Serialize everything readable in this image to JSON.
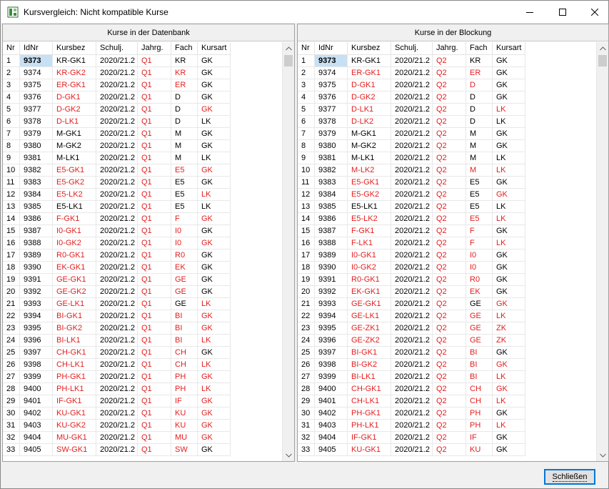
{
  "window": {
    "title": "Kursvergleich: Nicht kompatible Kurse"
  },
  "columns": [
    "Nr",
    "IdNr",
    "Kursbez",
    "Schulj.",
    "Jahrg.",
    "Fach",
    "Kursart"
  ],
  "left": {
    "title": "Kurse in der Datenbank",
    "rows": [
      [
        "1",
        "9373",
        "KR-GK1",
        "2020/21.2",
        "Q1",
        "KR",
        "GK"
      ],
      [
        "2",
        "9374",
        "KR-GK2",
        "2020/21.2",
        "Q1",
        "KR",
        "GK"
      ],
      [
        "3",
        "9375",
        "ER-GK1",
        "2020/21.2",
        "Q1",
        "ER",
        "GK"
      ],
      [
        "4",
        "9376",
        "D-GK1",
        "2020/21.2",
        "Q1",
        "D",
        "GK"
      ],
      [
        "5",
        "9377",
        "D-GK2",
        "2020/21.2",
        "Q1",
        "D",
        "GK"
      ],
      [
        "6",
        "9378",
        "D-LK1",
        "2020/21.2",
        "Q1",
        "D",
        "LK"
      ],
      [
        "7",
        "9379",
        "M-GK1",
        "2020/21.2",
        "Q1",
        "M",
        "GK"
      ],
      [
        "8",
        "9380",
        "M-GK2",
        "2020/21.2",
        "Q1",
        "M",
        "GK"
      ],
      [
        "9",
        "9381",
        "M-LK1",
        "2020/21.2",
        "Q1",
        "M",
        "LK"
      ],
      [
        "10",
        "9382",
        "E5-GK1",
        "2020/21.2",
        "Q1",
        "E5",
        "GK"
      ],
      [
        "11",
        "9383",
        "E5-GK2",
        "2020/21.2",
        "Q1",
        "E5",
        "GK"
      ],
      [
        "12",
        "9384",
        "E5-LK2",
        "2020/21.2",
        "Q1",
        "E5",
        "LK"
      ],
      [
        "13",
        "9385",
        "E5-LK1",
        "2020/21.2",
        "Q1",
        "E5",
        "LK"
      ],
      [
        "14",
        "9386",
        "F-GK1",
        "2020/21.2",
        "Q1",
        "F",
        "GK"
      ],
      [
        "15",
        "9387",
        "I0-GK1",
        "2020/21.2",
        "Q1",
        "I0",
        "GK"
      ],
      [
        "16",
        "9388",
        "I0-GK2",
        "2020/21.2",
        "Q1",
        "I0",
        "GK"
      ],
      [
        "17",
        "9389",
        "R0-GK1",
        "2020/21.2",
        "Q1",
        "R0",
        "GK"
      ],
      [
        "18",
        "9390",
        "EK-GK1",
        "2020/21.2",
        "Q1",
        "EK",
        "GK"
      ],
      [
        "19",
        "9391",
        "GE-GK1",
        "2020/21.2",
        "Q1",
        "GE",
        "GK"
      ],
      [
        "20",
        "9392",
        "GE-GK2",
        "2020/21.2",
        "Q1",
        "GE",
        "GK"
      ],
      [
        "21",
        "9393",
        "GE-LK1",
        "2020/21.2",
        "Q1",
        "GE",
        "LK"
      ],
      [
        "22",
        "9394",
        "BI-GK1",
        "2020/21.2",
        "Q1",
        "BI",
        "GK"
      ],
      [
        "23",
        "9395",
        "BI-GK2",
        "2020/21.2",
        "Q1",
        "BI",
        "GK"
      ],
      [
        "24",
        "9396",
        "BI-LK1",
        "2020/21.2",
        "Q1",
        "BI",
        "LK"
      ],
      [
        "25",
        "9397",
        "CH-GK1",
        "2020/21.2",
        "Q1",
        "CH",
        "GK"
      ],
      [
        "26",
        "9398",
        "CH-LK1",
        "2020/21.2",
        "Q1",
        "CH",
        "LK"
      ],
      [
        "27",
        "9399",
        "PH-GK1",
        "2020/21.2",
        "Q1",
        "PH",
        "GK"
      ],
      [
        "28",
        "9400",
        "PH-LK1",
        "2020/21.2",
        "Q1",
        "PH",
        "LK"
      ],
      [
        "29",
        "9401",
        "IF-GK1",
        "2020/21.2",
        "Q1",
        "IF",
        "GK"
      ],
      [
        "30",
        "9402",
        "KU-GK1",
        "2020/21.2",
        "Q1",
        "KU",
        "GK"
      ],
      [
        "31",
        "9403",
        "KU-GK2",
        "2020/21.2",
        "Q1",
        "KU",
        "GK"
      ],
      [
        "32",
        "9404",
        "MU-GK1",
        "2020/21.2",
        "Q1",
        "MU",
        "GK"
      ],
      [
        "33",
        "9405",
        "SW-GK1",
        "2020/21.2",
        "Q1",
        "SW",
        "GK"
      ]
    ],
    "red": [
      [
        0,
        0,
        0,
        0,
        1,
        0,
        0
      ],
      [
        0,
        0,
        1,
        0,
        1,
        1,
        0
      ],
      [
        0,
        0,
        1,
        0,
        1,
        1,
        0
      ],
      [
        0,
        0,
        1,
        0,
        1,
        0,
        0
      ],
      [
        0,
        0,
        1,
        0,
        1,
        0,
        1
      ],
      [
        0,
        0,
        1,
        0,
        1,
        0,
        0
      ],
      [
        0,
        0,
        0,
        0,
        1,
        0,
        0
      ],
      [
        0,
        0,
        0,
        0,
        1,
        0,
        0
      ],
      [
        0,
        0,
        0,
        0,
        1,
        0,
        0
      ],
      [
        0,
        0,
        1,
        0,
        1,
        1,
        1
      ],
      [
        0,
        0,
        1,
        0,
        1,
        0,
        0
      ],
      [
        0,
        0,
        1,
        0,
        1,
        0,
        1
      ],
      [
        0,
        0,
        0,
        0,
        1,
        0,
        0
      ],
      [
        0,
        0,
        1,
        0,
        1,
        1,
        1
      ],
      [
        0,
        0,
        1,
        0,
        1,
        1,
        0
      ],
      [
        0,
        0,
        1,
        0,
        1,
        1,
        1
      ],
      [
        0,
        0,
        1,
        0,
        1,
        1,
        0
      ],
      [
        0,
        0,
        1,
        0,
        1,
        1,
        0
      ],
      [
        0,
        0,
        1,
        0,
        1,
        1,
        0
      ],
      [
        0,
        0,
        1,
        0,
        1,
        1,
        0
      ],
      [
        0,
        0,
        1,
        0,
        1,
        0,
        1
      ],
      [
        0,
        0,
        1,
        0,
        1,
        1,
        1
      ],
      [
        0,
        0,
        1,
        0,
        1,
        1,
        1
      ],
      [
        0,
        0,
        1,
        0,
        1,
        1,
        1
      ],
      [
        0,
        0,
        1,
        0,
        1,
        1,
        0
      ],
      [
        0,
        0,
        1,
        0,
        1,
        1,
        1
      ],
      [
        0,
        0,
        1,
        0,
        1,
        1,
        1
      ],
      [
        0,
        0,
        1,
        0,
        1,
        1,
        1
      ],
      [
        0,
        0,
        1,
        0,
        1,
        1,
        1
      ],
      [
        0,
        0,
        1,
        0,
        1,
        1,
        1
      ],
      [
        0,
        0,
        1,
        0,
        1,
        1,
        1
      ],
      [
        0,
        0,
        1,
        0,
        1,
        1,
        1
      ],
      [
        0,
        0,
        1,
        0,
        1,
        1,
        0
      ]
    ]
  },
  "right": {
    "title": "Kurse in der Blockung",
    "rows": [
      [
        "1",
        "9373",
        "KR-GK1",
        "2020/21.2",
        "Q2",
        "KR",
        "GK"
      ],
      [
        "2",
        "9374",
        "ER-GK1",
        "2020/21.2",
        "Q2",
        "ER",
        "GK"
      ],
      [
        "3",
        "9375",
        "D-GK1",
        "2020/21.2",
        "Q2",
        "D",
        "GK"
      ],
      [
        "4",
        "9376",
        "D-GK2",
        "2020/21.2",
        "Q2",
        "D",
        "GK"
      ],
      [
        "5",
        "9377",
        "D-LK1",
        "2020/21.2",
        "Q2",
        "D",
        "LK"
      ],
      [
        "6",
        "9378",
        "D-LK2",
        "2020/21.2",
        "Q2",
        "D",
        "LK"
      ],
      [
        "7",
        "9379",
        "M-GK1",
        "2020/21.2",
        "Q2",
        "M",
        "GK"
      ],
      [
        "8",
        "9380",
        "M-GK2",
        "2020/21.2",
        "Q2",
        "M",
        "GK"
      ],
      [
        "9",
        "9381",
        "M-LK1",
        "2020/21.2",
        "Q2",
        "M",
        "LK"
      ],
      [
        "10",
        "9382",
        "M-LK2",
        "2020/21.2",
        "Q2",
        "M",
        "LK"
      ],
      [
        "11",
        "9383",
        "E5-GK1",
        "2020/21.2",
        "Q2",
        "E5",
        "GK"
      ],
      [
        "12",
        "9384",
        "E5-GK2",
        "2020/21.2",
        "Q2",
        "E5",
        "GK"
      ],
      [
        "13",
        "9385",
        "E5-LK1",
        "2020/21.2",
        "Q2",
        "E5",
        "LK"
      ],
      [
        "14",
        "9386",
        "E5-LK2",
        "2020/21.2",
        "Q2",
        "E5",
        "LK"
      ],
      [
        "15",
        "9387",
        "F-GK1",
        "2020/21.2",
        "Q2",
        "F",
        "GK"
      ],
      [
        "16",
        "9388",
        "F-LK1",
        "2020/21.2",
        "Q2",
        "F",
        "LK"
      ],
      [
        "17",
        "9389",
        "I0-GK1",
        "2020/21.2",
        "Q2",
        "I0",
        "GK"
      ],
      [
        "18",
        "9390",
        "I0-GK2",
        "2020/21.2",
        "Q2",
        "I0",
        "GK"
      ],
      [
        "19",
        "9391",
        "R0-GK1",
        "2020/21.2",
        "Q2",
        "R0",
        "GK"
      ],
      [
        "20",
        "9392",
        "EK-GK1",
        "2020/21.2",
        "Q2",
        "EK",
        "GK"
      ],
      [
        "21",
        "9393",
        "GE-GK1",
        "2020/21.2",
        "Q2",
        "GE",
        "GK"
      ],
      [
        "22",
        "9394",
        "GE-LK1",
        "2020/21.2",
        "Q2",
        "GE",
        "LK"
      ],
      [
        "23",
        "9395",
        "GE-ZK1",
        "2020/21.2",
        "Q2",
        "GE",
        "ZK"
      ],
      [
        "24",
        "9396",
        "GE-ZK2",
        "2020/21.2",
        "Q2",
        "GE",
        "ZK"
      ],
      [
        "25",
        "9397",
        "BI-GK1",
        "2020/21.2",
        "Q2",
        "BI",
        "GK"
      ],
      [
        "26",
        "9398",
        "BI-GK2",
        "2020/21.2",
        "Q2",
        "BI",
        "GK"
      ],
      [
        "27",
        "9399",
        "BI-LK1",
        "2020/21.2",
        "Q2",
        "BI",
        "LK"
      ],
      [
        "28",
        "9400",
        "CH-GK1",
        "2020/21.2",
        "Q2",
        "CH",
        "GK"
      ],
      [
        "29",
        "9401",
        "CH-LK1",
        "2020/21.2",
        "Q2",
        "CH",
        "LK"
      ],
      [
        "30",
        "9402",
        "PH-GK1",
        "2020/21.2",
        "Q2",
        "PH",
        "GK"
      ],
      [
        "31",
        "9403",
        "PH-LK1",
        "2020/21.2",
        "Q2",
        "PH",
        "LK"
      ],
      [
        "32",
        "9404",
        "IF-GK1",
        "2020/21.2",
        "Q2",
        "IF",
        "GK"
      ],
      [
        "33",
        "9405",
        "KU-GK1",
        "2020/21.2",
        "Q2",
        "KU",
        "GK"
      ]
    ],
    "red": [
      [
        0,
        0,
        0,
        0,
        1,
        0,
        0
      ],
      [
        0,
        0,
        1,
        0,
        1,
        1,
        0
      ],
      [
        0,
        0,
        1,
        0,
        1,
        1,
        0
      ],
      [
        0,
        0,
        1,
        0,
        1,
        0,
        0
      ],
      [
        0,
        0,
        1,
        0,
        1,
        0,
        1
      ],
      [
        0,
        0,
        1,
        0,
        1,
        0,
        0
      ],
      [
        0,
        0,
        0,
        0,
        1,
        0,
        0
      ],
      [
        0,
        0,
        0,
        0,
        1,
        0,
        0
      ],
      [
        0,
        0,
        0,
        0,
        1,
        0,
        0
      ],
      [
        0,
        0,
        1,
        0,
        1,
        1,
        1
      ],
      [
        0,
        0,
        1,
        0,
        1,
        0,
        0
      ],
      [
        0,
        0,
        1,
        0,
        1,
        0,
        1
      ],
      [
        0,
        0,
        0,
        0,
        1,
        0,
        0
      ],
      [
        0,
        0,
        1,
        0,
        1,
        1,
        1
      ],
      [
        0,
        0,
        1,
        0,
        1,
        1,
        0
      ],
      [
        0,
        0,
        1,
        0,
        1,
        1,
        1
      ],
      [
        0,
        0,
        1,
        0,
        1,
        1,
        0
      ],
      [
        0,
        0,
        1,
        0,
        1,
        1,
        0
      ],
      [
        0,
        0,
        1,
        0,
        1,
        1,
        0
      ],
      [
        0,
        0,
        1,
        0,
        1,
        1,
        0
      ],
      [
        0,
        0,
        1,
        0,
        1,
        0,
        1
      ],
      [
        0,
        0,
        1,
        0,
        1,
        1,
        1
      ],
      [
        0,
        0,
        1,
        0,
        1,
        1,
        1
      ],
      [
        0,
        0,
        1,
        0,
        1,
        1,
        1
      ],
      [
        0,
        0,
        1,
        0,
        1,
        1,
        0
      ],
      [
        0,
        0,
        1,
        0,
        1,
        1,
        1
      ],
      [
        0,
        0,
        1,
        0,
        1,
        1,
        1
      ],
      [
        0,
        0,
        1,
        0,
        1,
        1,
        1
      ],
      [
        0,
        0,
        1,
        0,
        1,
        1,
        1
      ],
      [
        0,
        0,
        1,
        0,
        1,
        1,
        0
      ],
      [
        0,
        0,
        1,
        0,
        1,
        1,
        1
      ],
      [
        0,
        0,
        1,
        0,
        1,
        1,
        0
      ],
      [
        0,
        0,
        1,
        0,
        1,
        1,
        0
      ]
    ]
  },
  "selected_row": 0,
  "selected_col": 1,
  "close_button_label": "Schließen",
  "colors": {
    "mismatch": "#e41e1e",
    "selection": "#c7e0f4",
    "focus": "#0078d7"
  }
}
